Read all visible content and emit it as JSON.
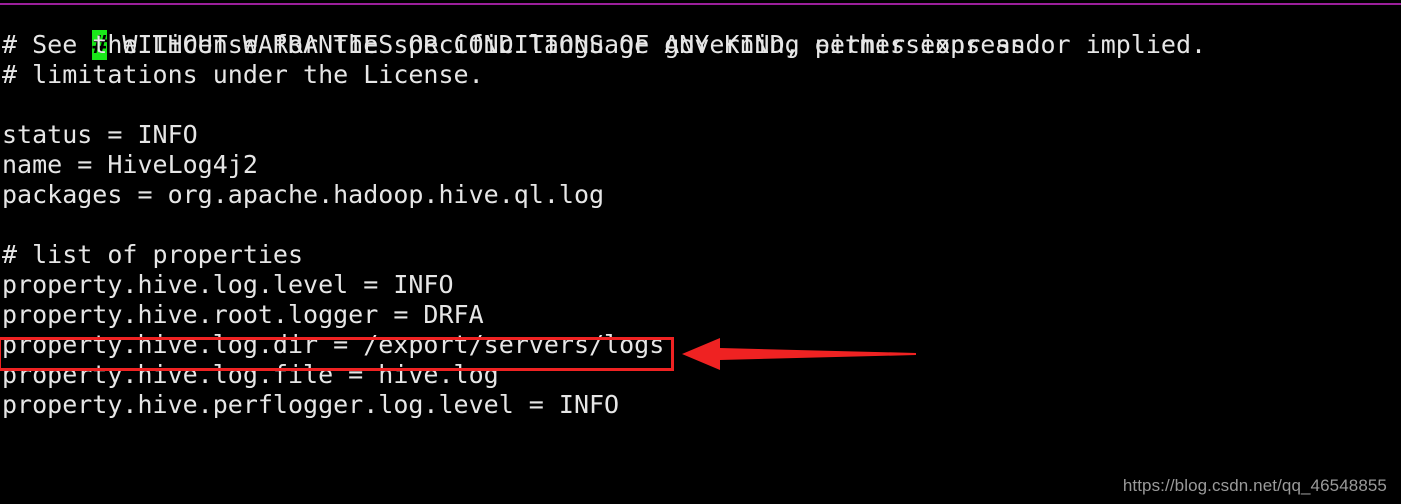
{
  "terminal": {
    "background_color": "#000000",
    "foreground_color": "#e6e6e6",
    "top_rule_color": "#9b1f9b",
    "cursor": {
      "character": "#",
      "background_color": "#19e619",
      "foreground_color": "#000000"
    },
    "lines": [
      {
        "id": "line-1",
        "text": " WITHOUT WARRANTIES OR CONDITIONS OF ANY KIND, either express or implied.",
        "has_cursor": true
      },
      {
        "id": "line-2",
        "text": "# See the License for the specific language governing permissions and",
        "has_cursor": false
      },
      {
        "id": "line-3",
        "text": "# limitations under the License.",
        "has_cursor": false
      },
      {
        "id": "line-4",
        "text": "",
        "has_cursor": false
      },
      {
        "id": "line-5",
        "text": "status = INFO",
        "has_cursor": false
      },
      {
        "id": "line-6",
        "text": "name = HiveLog4j2",
        "has_cursor": false
      },
      {
        "id": "line-7",
        "text": "packages = org.apache.hadoop.hive.ql.log",
        "has_cursor": false
      },
      {
        "id": "line-8",
        "text": "",
        "has_cursor": false
      },
      {
        "id": "line-9",
        "text": "# list of properties",
        "has_cursor": false
      },
      {
        "id": "line-10",
        "text": "property.hive.log.level = INFO",
        "has_cursor": false
      },
      {
        "id": "line-11",
        "text": "property.hive.root.logger = DRFA",
        "has_cursor": false
      },
      {
        "id": "line-12",
        "text": "property.hive.log.dir = /export/servers/logs",
        "has_cursor": false
      },
      {
        "id": "line-13",
        "text": "property.hive.log.file = hive.log",
        "has_cursor": false
      },
      {
        "id": "line-14",
        "text": "property.hive.perflogger.log.level = INFO",
        "has_cursor": false
      }
    ]
  },
  "annotation": {
    "color": "#ef2222",
    "highlighted_line_text": "property.hive.log.dir = /export/servers/logs",
    "arrow_direction": "left"
  },
  "watermark": {
    "text": "https://blog.csdn.net/qq_46548855",
    "color": "#9a9a9a"
  }
}
